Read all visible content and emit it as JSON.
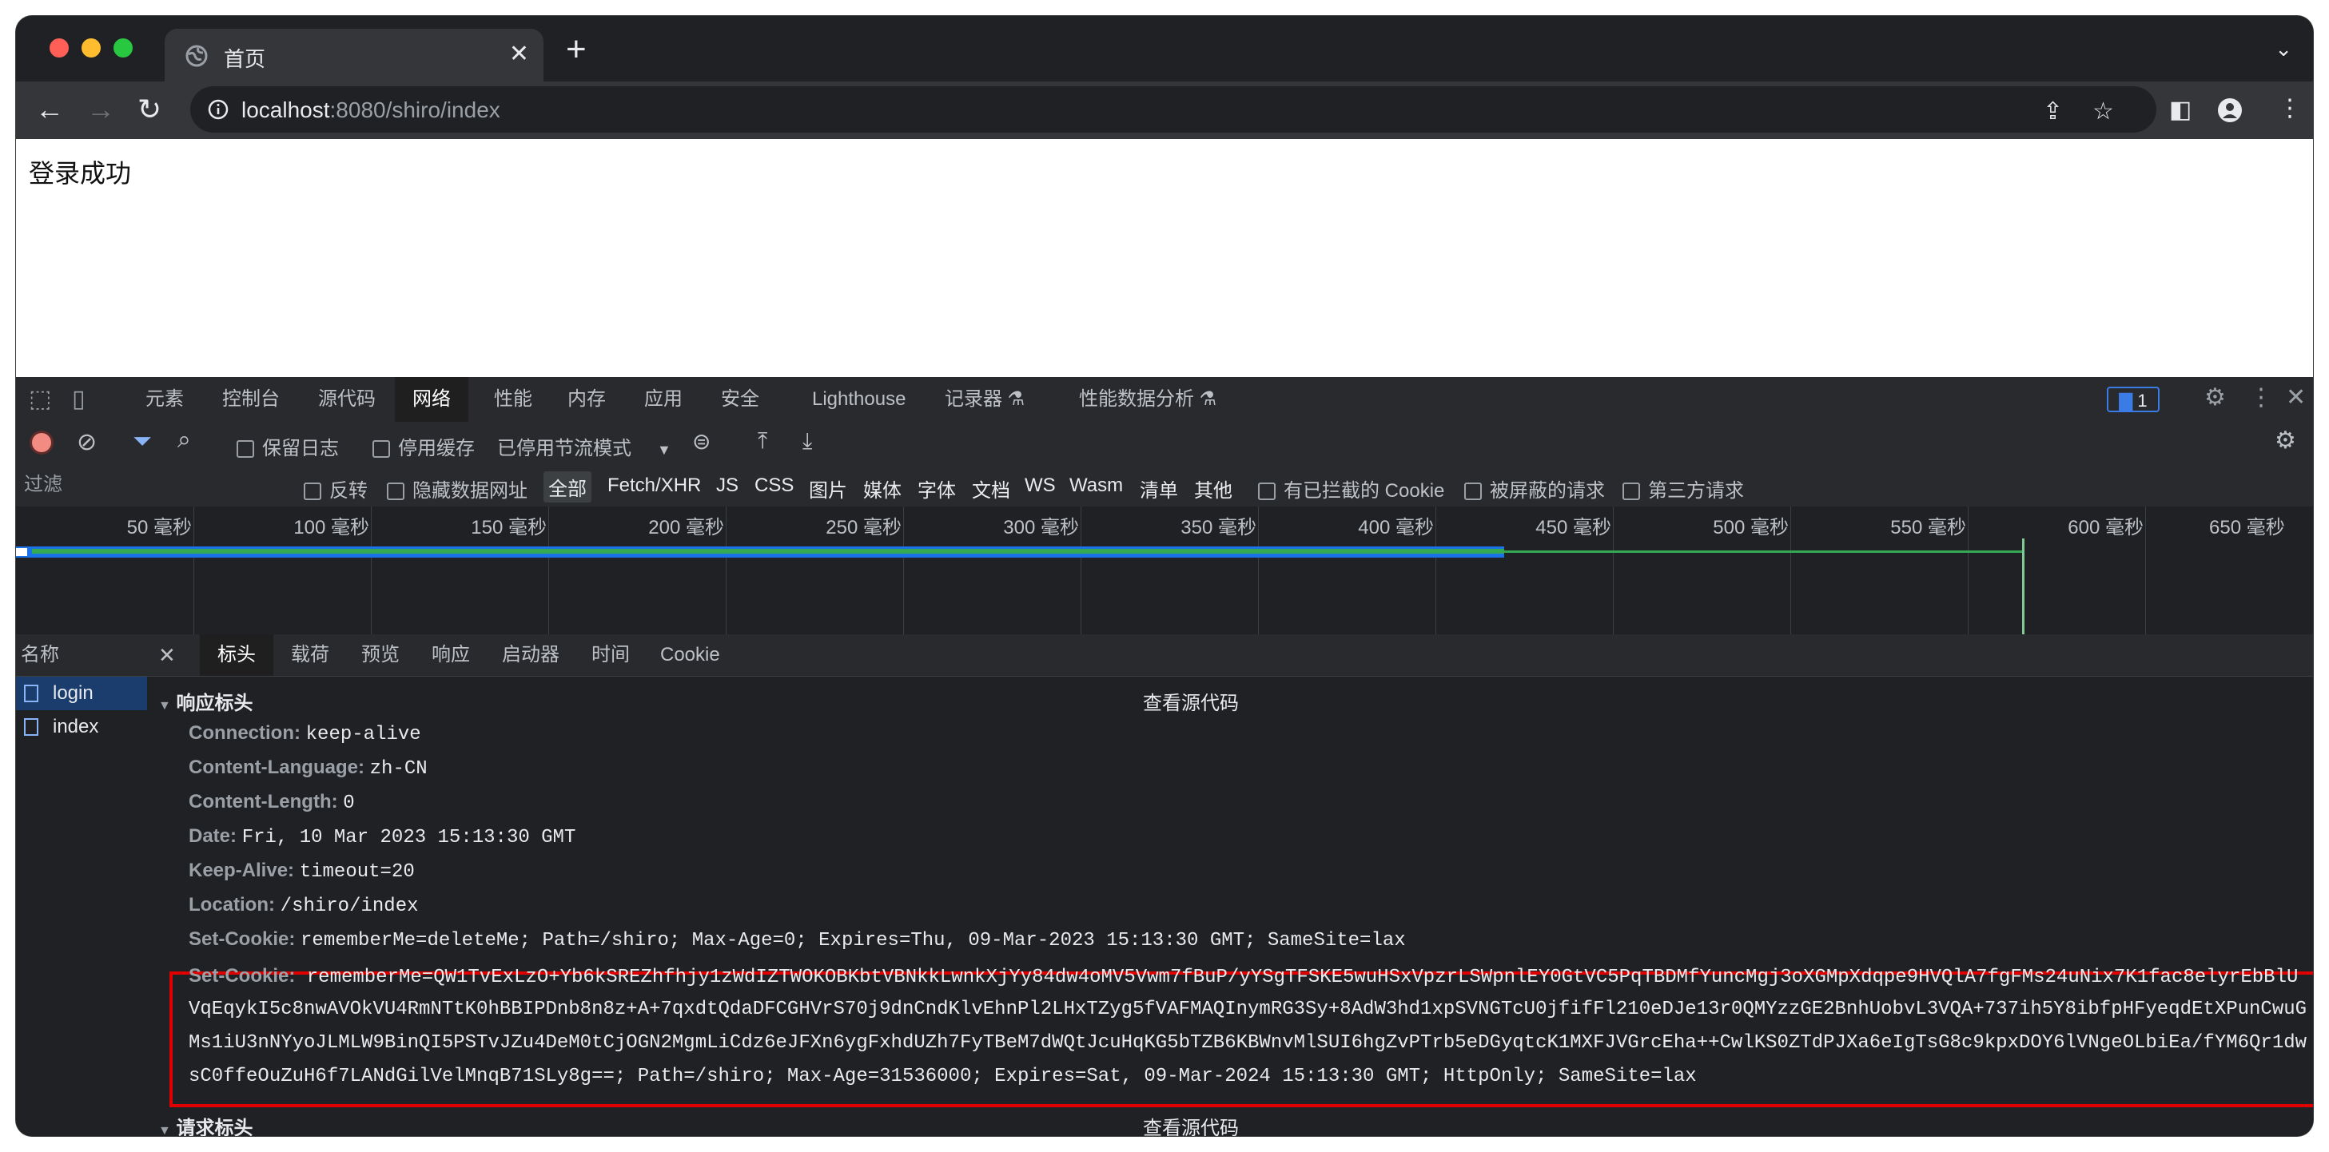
{
  "tab": {
    "title": "首页",
    "close": "✕",
    "new": "+"
  },
  "toolbar": {
    "url_host": "localhost",
    "url_rest": ":8080/shiro/index"
  },
  "page": {
    "text": "登录成功"
  },
  "devtools": {
    "tabs": [
      "元素",
      "控制台",
      "源代码",
      "网络",
      "性能",
      "内存",
      "应用",
      "安全",
      "Lighthouse",
      "记录器 ⚗",
      "性能数据分析 ⚗"
    ],
    "active_tab": "网络",
    "issues_count": "1",
    "network_toolbar": {
      "preserve_log": "保留日志",
      "disable_cache": "停用缓存",
      "throttle": "已停用节流模式"
    },
    "filter": {
      "placeholder": "过滤",
      "invert": "反转",
      "hide_data_urls": "隐藏数据网址",
      "types": [
        "全部",
        "Fetch/XHR",
        "JS",
        "CSS",
        "图片",
        "媒体",
        "字体",
        "文档",
        "WS",
        "Wasm",
        "清单",
        "其他"
      ],
      "blocked_cookies": "有已拦截的 Cookie",
      "blocked_requests": "被屏蔽的请求",
      "third_party": "第三方请求"
    },
    "timeline_ticks": [
      "50 毫秒",
      "100 毫秒",
      "150 毫秒",
      "200 毫秒",
      "250 毫秒",
      "300 毫秒",
      "350 毫秒",
      "400 毫秒",
      "450 毫秒",
      "500 毫秒",
      "550 毫秒",
      "600 毫秒",
      "650 毫秒"
    ],
    "name_header": "名称",
    "requests": [
      "login",
      "index"
    ],
    "detail_tabs": [
      "标头",
      "载荷",
      "预览",
      "响应",
      "启动器",
      "时间",
      "Cookie"
    ],
    "response_section": "响应标头",
    "view_source": "查看源代码",
    "headers": [
      {
        "k": "Connection:",
        "v": "keep-alive"
      },
      {
        "k": "Content-Language:",
        "v": "zh-CN"
      },
      {
        "k": "Content-Length:",
        "v": "0"
      },
      {
        "k": "Date:",
        "v": "Fri, 10 Mar 2023 15:13:30 GMT"
      },
      {
        "k": "Keep-Alive:",
        "v": "timeout=20"
      },
      {
        "k": "Location:",
        "v": "/shiro/index"
      },
      {
        "k": "Set-Cookie:",
        "v": "rememberMe=deleteMe; Path=/shiro; Max-Age=0; Expires=Thu, 09-Mar-2023 15:13:30 GMT; SameSite=lax"
      }
    ],
    "set_cookie": {
      "k": "Set-Cookie:",
      "line1": "rememberMe=QW1TvExLzO+Yb6kSREZhfhjy1zWdIZTWOKOBKbtVBNkkLwnkXjYy84dw4oMV5Vwm7fBuP/yYSgTFSKE5wuHSxVpzrLSWpnlEY0GtVC5PqTBDMfYuncMgj3oXGMpXdqpe9HVQlA7fgFMs24uNix7K1fac8elyrEbBlU",
      "line2": "VqEqykI5c8nwAVOkVU4RmNTtK0hBBIPDnb8n8z+A+7qxdtQdaDFCGHVrS70j9dnCndKlvEhnPl2LHxTZyg5fVAFMAQInymRG3Sy+8AdW3hd1xpSVNGTcU0jfifFl210eDJe13r0QMYzzGE2BnhUobvL3VQA+737ih5Y8ibfpHFyeqdEtXPunCwuG",
      "line3": "Ms1iU3nNYyoJLMLW9BinQI5PSTvJZu4DeM0tCjOGN2MgmLiCdz6eJFXn6ygFxhdUZh7FyTBeM7dWQtJcuHqKG5bTZB6KBWnvMlSUI6hgZvPTrb5eDGyqtcK1MXFJVGrcEha++CwlKS0ZTdPJXa6eIgTsG8c9kpxDOY6lVNgeOLbiEa/fYM6Qr1dw",
      "line4": "sC0ffeOuZuH6f7LANdGilVelMnqB71SLy8g==; Path=/shiro; Max-Age=31536000; Expires=Sat, 09-Mar-2024 15:13:30 GMT; HttpOnly; SameSite=lax"
    },
    "request_section": "请求标头",
    "view_source2": "查看源代码"
  },
  "colors": {
    "highlight_box": "#e00000",
    "accent": "#1a73e8",
    "timeline_green": "#34a853"
  }
}
